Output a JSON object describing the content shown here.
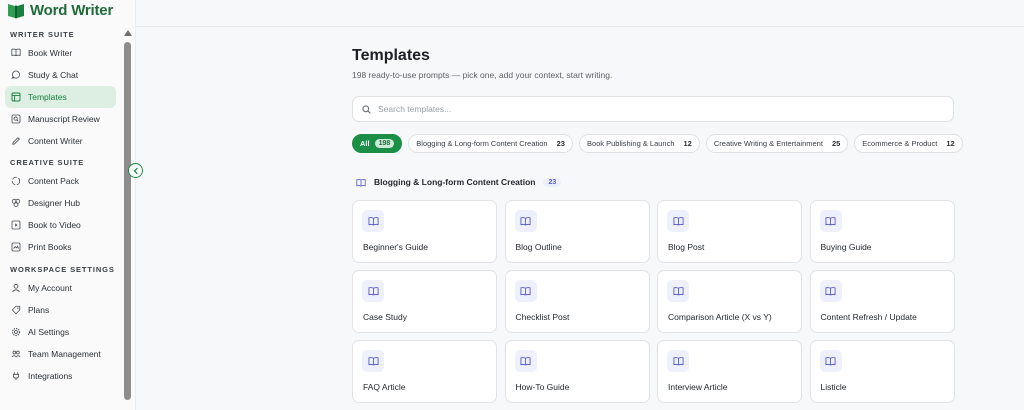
{
  "app": {
    "name": "Word Writer",
    "brand_color": "#1a8f45"
  },
  "sidebar": {
    "sections": [
      {
        "title": "WRITER SUITE",
        "items": [
          {
            "label": "Book Writer",
            "icon": "book-icon",
            "active": false
          },
          {
            "label": "Study & Chat",
            "icon": "chat-icon",
            "active": false
          },
          {
            "label": "Templates",
            "icon": "template-icon",
            "active": true
          },
          {
            "label": "Manuscript Review",
            "icon": "review-icon",
            "active": false
          },
          {
            "label": "Content Writer",
            "icon": "pen-icon",
            "active": false
          }
        ]
      },
      {
        "title": "CREATIVE SUITE",
        "items": [
          {
            "label": "Content Pack",
            "icon": "pack-icon",
            "active": false
          },
          {
            "label": "Designer Hub",
            "icon": "palette-icon",
            "active": false
          },
          {
            "label": "Book to Video",
            "icon": "video-icon",
            "active": false
          },
          {
            "label": "Print Books",
            "icon": "print-icon",
            "active": false
          }
        ]
      },
      {
        "title": "WORKSPACE SETTINGS",
        "items": [
          {
            "label": "My Account",
            "icon": "user-icon",
            "active": false
          },
          {
            "label": "Plans",
            "icon": "tag-icon",
            "active": false
          },
          {
            "label": "AI Settings",
            "icon": "gear-icon",
            "active": false
          },
          {
            "label": "Team Management",
            "icon": "team-icon",
            "active": false
          },
          {
            "label": "Integrations",
            "icon": "plug-icon",
            "active": false
          }
        ]
      }
    ]
  },
  "main": {
    "title": "Templates",
    "subtitle": "198 ready-to-use prompts — pick one, add your context, start writing.",
    "search_placeholder": "Search templates...",
    "filters": [
      {
        "label": "All",
        "count": "198",
        "active": true
      },
      {
        "label": "Blogging & Long-form Content Creation",
        "count": "23",
        "active": false
      },
      {
        "label": "Book Publishing & Launch",
        "count": "12",
        "active": false
      },
      {
        "label": "Creative Writing & Entertainment",
        "count": "25",
        "active": false
      },
      {
        "label": "Ecommerce & Product",
        "count": "12",
        "active": false
      }
    ],
    "category": {
      "label": "Blogging & Long-form Content Creation",
      "count": "23"
    },
    "templates": [
      "Beginner's Guide",
      "Blog Outline",
      "Blog Post",
      "Buying Guide",
      "Case Study",
      "Checklist Post",
      "Comparison Article (X vs Y)",
      "Content Refresh / Update",
      "FAQ Article",
      "How-To Guide",
      "Interview Article",
      "Listicle"
    ]
  }
}
